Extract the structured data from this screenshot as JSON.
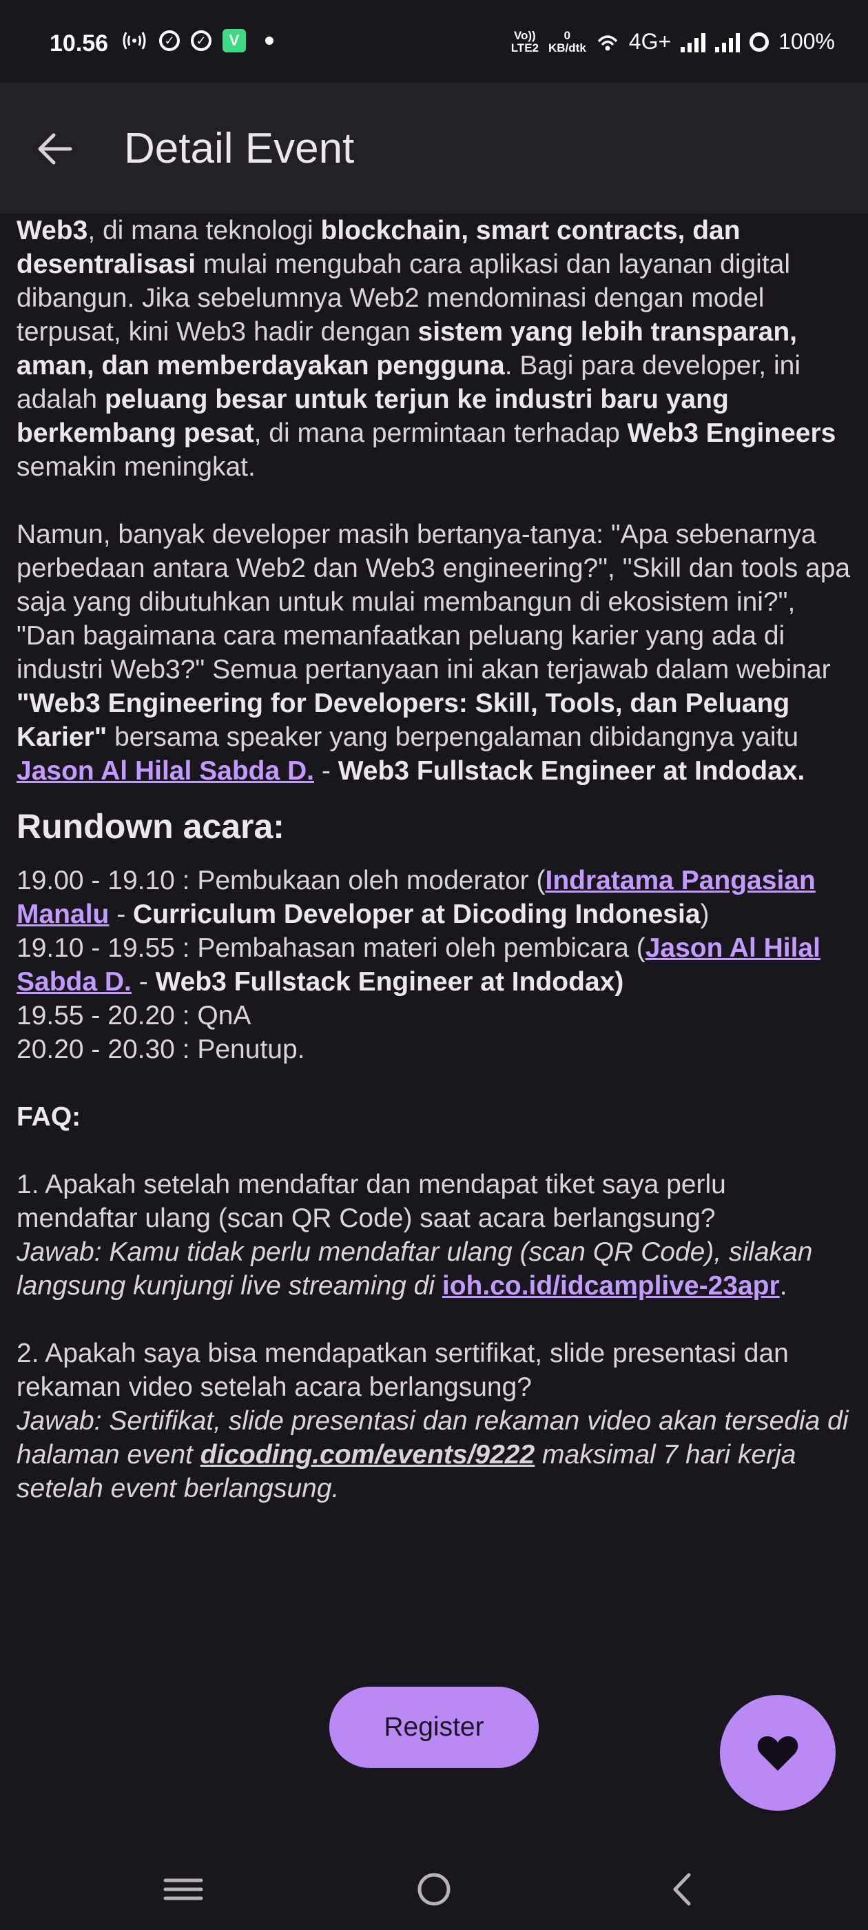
{
  "status_bar": {
    "time": "10.56",
    "network_left": "Vo))\nLTE2",
    "speed": "0\nKB/dtk",
    "network_type": "4G+",
    "battery": "100%"
  },
  "app_bar": {
    "title": "Detail Event",
    "back_icon": "arrow-left-icon"
  },
  "content": {
    "intro_html": "<b>Web3</b>, di mana teknologi <b>blockchain, smart contracts, dan desentralisasi</b> mulai mengubah cara aplikasi dan layanan digital dibangun. Jika sebelumnya Web2 mendominasi dengan model terpusat, kini Web3 hadir dengan <b>sistem yang lebih transparan, aman, dan memberdayakan pengguna</b>. Bagi para developer, ini adalah <b>peluang besar untuk terjun ke industri baru yang berkembang pesat</b>, di mana permintaan terhadap <b>Web3 Engineers</b> semakin meningkat.",
    "para2_text": "Namun, banyak developer masih bertanya-tanya: \"Apa sebenarnya perbedaan antara Web2 dan Web3 engineering?\", \"Skill dan tools apa saja yang dibutuhkan untuk mulai membangun di ekosistem ini?\", \"Dan bagaimana cara memanfaatkan peluang karier yang ada di industri Web3?\" Semua pertanyaan ini akan terjawab dalam webinar ",
    "para2_bold": "\"Web3 Engineering for Developers: Skill, Tools, dan Peluang Karier\"",
    "para2_after": " bersama speaker yang berpengalaman dibidangnya yaitu ",
    "speaker_link": "Jason Al Hilal Sabda D.",
    "speaker_sep": " - ",
    "speaker_role": "Web3 Fullstack Engineer at Indodax.",
    "rundown_heading": "Rundown acara:",
    "rundown1_pre": "19.00 - 19.10 : Pembukaan oleh moderator (",
    "rundown1_link": "Indratama Pangasian Manalu",
    "rundown1_sep": " - ",
    "rundown1_role": "Curriculum Developer at Dicoding Indonesia",
    "rundown1_post": ")",
    "rundown2_pre": "19.10 - 19.55 : Pembahasan materi oleh pembicara (",
    "rundown2_link": "Jason Al Hilal Sabda D.",
    "rundown2_sep": " - ",
    "rundown2_role": "Web3 Fullstack Engineer at Indodax)",
    "rundown3": "19.55 - 20.20 : QnA",
    "rundown4": "20.20 - 20.30 : Penutup.",
    "faq_heading": "FAQ:",
    "faq1_q": "1. Apakah setelah mendaftar dan mendapat tiket saya perlu mendaftar ulang (scan QR Code) saat acara berlangsung?",
    "faq1_a": "Jawab: Kamu tidak perlu mendaftar ulang (scan QR Code), silakan langsung kunjungi live streaming di ",
    "faq1_link": "ioh.co.id/idcamplive-23apr",
    "faq1_end": ".",
    "faq2_q": "2. Apakah saya bisa mendapatkan sertifikat, slide presentasi dan rekaman video setelah acara berlangsung?",
    "faq2_a": "Jawab: Sertifikat, slide presentasi dan rekaman video akan tersedia di halaman event ",
    "faq2_link": "dicoding.com/events/9222",
    "faq2_end": " maksimal 7 hari kerja setelah event berlangsung."
  },
  "register_label": "Register",
  "fab_icon": "heart-icon",
  "nav_bar": {
    "recents_icon": "menu-icon",
    "home_icon": "home-circle-icon",
    "back_icon": "chevron-left-icon"
  },
  "colors": {
    "background": "#19171d",
    "app_bar": "#232126",
    "accent": "#b98af6",
    "link": "#c39bff"
  }
}
